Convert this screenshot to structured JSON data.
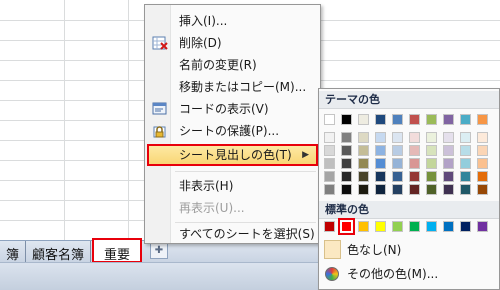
{
  "context_menu": {
    "items": [
      {
        "label": "挿入(I)...",
        "icon": "none",
        "enabled": true
      },
      {
        "label": "削除(D)",
        "icon": "delete-sheet-icon",
        "enabled": true
      },
      {
        "label": "名前の変更(R)",
        "icon": "none",
        "enabled": true
      },
      {
        "label": "移動またはコピー(M)...",
        "icon": "none",
        "enabled": true
      },
      {
        "label": "コードの表示(V)",
        "icon": "view-code-icon",
        "enabled": true
      },
      {
        "label": "シートの保護(P)...",
        "icon": "protect-sheet-icon",
        "enabled": true
      },
      {
        "label": "シート見出しの色(T)",
        "icon": "none",
        "enabled": true,
        "highlighted": true,
        "has_submenu": true
      },
      {
        "label": "非表示(H)",
        "icon": "none",
        "enabled": true
      },
      {
        "label": "再表示(U)...",
        "icon": "none",
        "enabled": false
      },
      {
        "label": "すべてのシートを選択(S)",
        "icon": "none",
        "enabled": true
      }
    ]
  },
  "color_menu": {
    "theme_header": "テーマの色",
    "standard_header": "標準の色",
    "theme_top_row": [
      "#ffffff",
      "#000000",
      "#eeece1",
      "#1f497d",
      "#4f81bd",
      "#c0504d",
      "#9bbb59",
      "#8064a2",
      "#4bacc6",
      "#f79646"
    ],
    "theme_shades": [
      [
        "#f2f2f2",
        "#7f7f7f",
        "#ddd9c3",
        "#c6d9f0",
        "#dbe5f1",
        "#f2dcdb",
        "#ebf1dd",
        "#e5e0ec",
        "#dbeef3",
        "#fdeada"
      ],
      [
        "#d8d8d8",
        "#595959",
        "#c4bd97",
        "#8db3e2",
        "#b8cce4",
        "#e5b9b7",
        "#d7e3bc",
        "#ccc1d9",
        "#b7dde8",
        "#fbd5b5"
      ],
      [
        "#bfbfbf",
        "#3f3f3f",
        "#938953",
        "#548dd4",
        "#95b3d7",
        "#d99694",
        "#c3d69b",
        "#b2a2c7",
        "#92cddc",
        "#fac08f"
      ],
      [
        "#a5a5a5",
        "#262626",
        "#494429",
        "#17365d",
        "#366092",
        "#953734",
        "#76923c",
        "#5f497a",
        "#31859b",
        "#e36c09"
      ],
      [
        "#7f7f7f",
        "#0c0c0c",
        "#1d1b10",
        "#0f243e",
        "#244061",
        "#632423",
        "#4f6128",
        "#3f3151",
        "#205867",
        "#974806"
      ]
    ],
    "standard_colors": [
      "#c00000",
      "#ff0000",
      "#ffc000",
      "#ffff00",
      "#92d050",
      "#00b050",
      "#00b0f0",
      "#0070c0",
      "#002060",
      "#7030a0"
    ],
    "selected_standard_index": 1,
    "no_color_label": "色なし(N)",
    "more_colors_label": "その他の色(M)..."
  },
  "sheet_tabs": {
    "tabs": [
      "簿",
      "顧客名簿",
      "重要"
    ],
    "active_index": 2
  }
}
